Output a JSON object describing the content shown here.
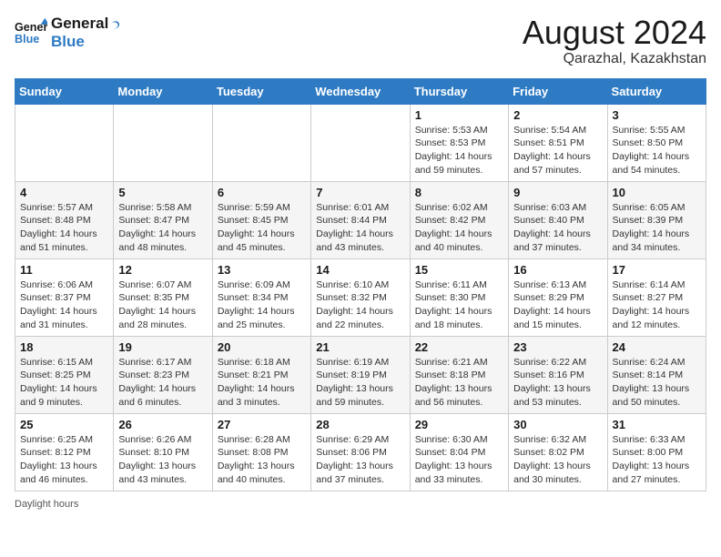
{
  "header": {
    "logo_line1": "General",
    "logo_line2": "Blue",
    "month_year": "August 2024",
    "location": "Qarazhal, Kazakhstan"
  },
  "weekdays": [
    "Sunday",
    "Monday",
    "Tuesday",
    "Wednesday",
    "Thursday",
    "Friday",
    "Saturday"
  ],
  "weeks": [
    [
      {
        "day": "",
        "info": ""
      },
      {
        "day": "",
        "info": ""
      },
      {
        "day": "",
        "info": ""
      },
      {
        "day": "",
        "info": ""
      },
      {
        "day": "1",
        "info": "Sunrise: 5:53 AM\nSunset: 8:53 PM\nDaylight: 14 hours and 59 minutes."
      },
      {
        "day": "2",
        "info": "Sunrise: 5:54 AM\nSunset: 8:51 PM\nDaylight: 14 hours and 57 minutes."
      },
      {
        "day": "3",
        "info": "Sunrise: 5:55 AM\nSunset: 8:50 PM\nDaylight: 14 hours and 54 minutes."
      }
    ],
    [
      {
        "day": "4",
        "info": "Sunrise: 5:57 AM\nSunset: 8:48 PM\nDaylight: 14 hours and 51 minutes."
      },
      {
        "day": "5",
        "info": "Sunrise: 5:58 AM\nSunset: 8:47 PM\nDaylight: 14 hours and 48 minutes."
      },
      {
        "day": "6",
        "info": "Sunrise: 5:59 AM\nSunset: 8:45 PM\nDaylight: 14 hours and 45 minutes."
      },
      {
        "day": "7",
        "info": "Sunrise: 6:01 AM\nSunset: 8:44 PM\nDaylight: 14 hours and 43 minutes."
      },
      {
        "day": "8",
        "info": "Sunrise: 6:02 AM\nSunset: 8:42 PM\nDaylight: 14 hours and 40 minutes."
      },
      {
        "day": "9",
        "info": "Sunrise: 6:03 AM\nSunset: 8:40 PM\nDaylight: 14 hours and 37 minutes."
      },
      {
        "day": "10",
        "info": "Sunrise: 6:05 AM\nSunset: 8:39 PM\nDaylight: 14 hours and 34 minutes."
      }
    ],
    [
      {
        "day": "11",
        "info": "Sunrise: 6:06 AM\nSunset: 8:37 PM\nDaylight: 14 hours and 31 minutes."
      },
      {
        "day": "12",
        "info": "Sunrise: 6:07 AM\nSunset: 8:35 PM\nDaylight: 14 hours and 28 minutes."
      },
      {
        "day": "13",
        "info": "Sunrise: 6:09 AM\nSunset: 8:34 PM\nDaylight: 14 hours and 25 minutes."
      },
      {
        "day": "14",
        "info": "Sunrise: 6:10 AM\nSunset: 8:32 PM\nDaylight: 14 hours and 22 minutes."
      },
      {
        "day": "15",
        "info": "Sunrise: 6:11 AM\nSunset: 8:30 PM\nDaylight: 14 hours and 18 minutes."
      },
      {
        "day": "16",
        "info": "Sunrise: 6:13 AM\nSunset: 8:29 PM\nDaylight: 14 hours and 15 minutes."
      },
      {
        "day": "17",
        "info": "Sunrise: 6:14 AM\nSunset: 8:27 PM\nDaylight: 14 hours and 12 minutes."
      }
    ],
    [
      {
        "day": "18",
        "info": "Sunrise: 6:15 AM\nSunset: 8:25 PM\nDaylight: 14 hours and 9 minutes."
      },
      {
        "day": "19",
        "info": "Sunrise: 6:17 AM\nSunset: 8:23 PM\nDaylight: 14 hours and 6 minutes."
      },
      {
        "day": "20",
        "info": "Sunrise: 6:18 AM\nSunset: 8:21 PM\nDaylight: 14 hours and 3 minutes."
      },
      {
        "day": "21",
        "info": "Sunrise: 6:19 AM\nSunset: 8:19 PM\nDaylight: 13 hours and 59 minutes."
      },
      {
        "day": "22",
        "info": "Sunrise: 6:21 AM\nSunset: 8:18 PM\nDaylight: 13 hours and 56 minutes."
      },
      {
        "day": "23",
        "info": "Sunrise: 6:22 AM\nSunset: 8:16 PM\nDaylight: 13 hours and 53 minutes."
      },
      {
        "day": "24",
        "info": "Sunrise: 6:24 AM\nSunset: 8:14 PM\nDaylight: 13 hours and 50 minutes."
      }
    ],
    [
      {
        "day": "25",
        "info": "Sunrise: 6:25 AM\nSunset: 8:12 PM\nDaylight: 13 hours and 46 minutes."
      },
      {
        "day": "26",
        "info": "Sunrise: 6:26 AM\nSunset: 8:10 PM\nDaylight: 13 hours and 43 minutes."
      },
      {
        "day": "27",
        "info": "Sunrise: 6:28 AM\nSunset: 8:08 PM\nDaylight: 13 hours and 40 minutes."
      },
      {
        "day": "28",
        "info": "Sunrise: 6:29 AM\nSunset: 8:06 PM\nDaylight: 13 hours and 37 minutes."
      },
      {
        "day": "29",
        "info": "Sunrise: 6:30 AM\nSunset: 8:04 PM\nDaylight: 13 hours and 33 minutes."
      },
      {
        "day": "30",
        "info": "Sunrise: 6:32 AM\nSunset: 8:02 PM\nDaylight: 13 hours and 30 minutes."
      },
      {
        "day": "31",
        "info": "Sunrise: 6:33 AM\nSunset: 8:00 PM\nDaylight: 13 hours and 27 minutes."
      }
    ]
  ],
  "footer": {
    "daylight_label": "Daylight hours"
  }
}
